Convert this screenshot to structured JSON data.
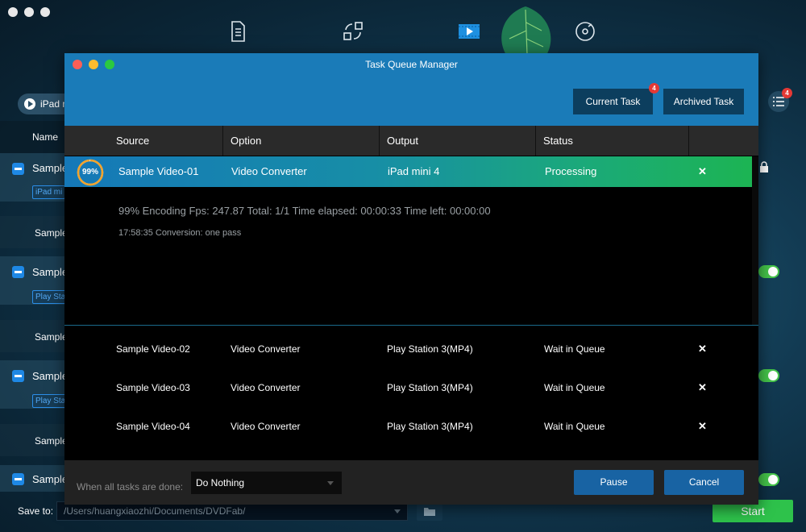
{
  "background": {
    "toolbar_icons": [
      "document-icon",
      "convert-icon",
      "video-icon",
      "disc-icon"
    ],
    "device_button_label": "iPad m",
    "list_header_name": "Name",
    "rows": [
      {
        "title": "Sample",
        "tag": "iPad mi"
      },
      {
        "sub": "Sample"
      },
      {
        "title": "Sample",
        "tag": "Play Statio"
      },
      {
        "sub": "Sample"
      },
      {
        "title": "Sample",
        "tag": "Play Statio"
      },
      {
        "sub": "Sample"
      },
      {
        "title": "Sample"
      }
    ],
    "menu_badge": "4",
    "save_to_label": "Save to:",
    "save_path": "/Users/huangxiaozhi/Documents/DVDFab/",
    "start_label": "Start"
  },
  "dialog": {
    "title": "Task Queue Manager",
    "tabs": {
      "current": "Current Task",
      "current_badge": "4",
      "archived": "Archived Task"
    },
    "columns": {
      "source": "Source",
      "option": "Option",
      "output": "Output",
      "status": "Status"
    },
    "active_task": {
      "progress_label": "99%",
      "progress": 0.99,
      "source": "Sample Video-01",
      "option": "Video Converter",
      "output": "iPad mini 4",
      "status": "Processing",
      "remove": "✕"
    },
    "detail_line1": "99%  Encoding Fps: 247.87   Total: 1/1  Time elapsed: 00:00:33  Time left: 00:00:00",
    "detail_line2": "17:58:35     Conversion: one pass",
    "queue": [
      {
        "source": "Sample Video-02",
        "option": "Video Converter",
        "output": "Play Station 3(MP4)",
        "status": "Wait in Queue",
        "remove": "✕"
      },
      {
        "source": "Sample Video-03",
        "option": "Video Converter",
        "output": "Play Station 3(MP4)",
        "status": "Wait in Queue",
        "remove": "✕"
      },
      {
        "source": "Sample Video-04",
        "option": "Video Converter",
        "output": "Play Station 3(MP4)",
        "status": "Wait in Queue",
        "remove": "✕"
      }
    ],
    "footer": {
      "when_done_label": "When all tasks are done:",
      "when_done_value": "Do Nothing",
      "pause_label": "Pause",
      "cancel_label": "Cancel"
    }
  }
}
